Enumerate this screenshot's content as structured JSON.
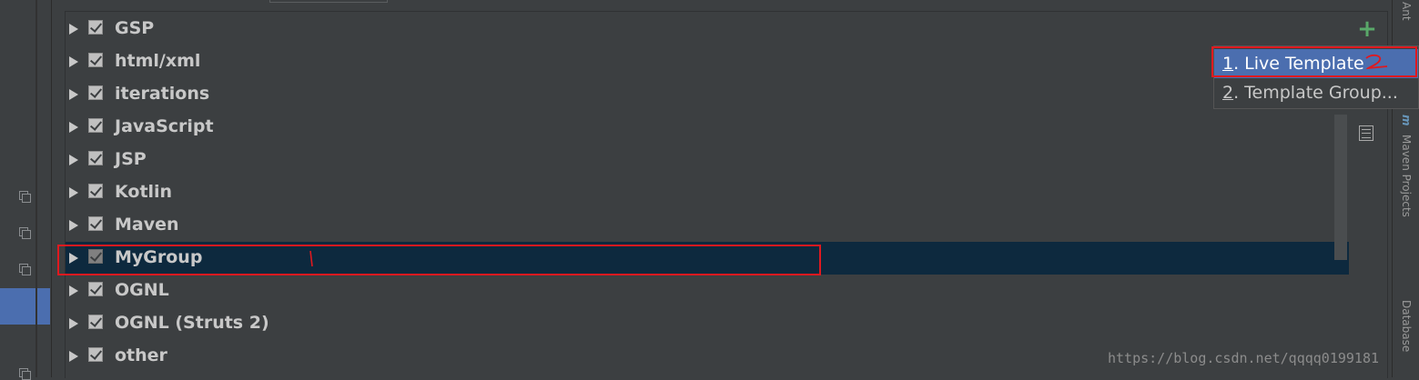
{
  "groups": [
    {
      "label": "GSP",
      "checked": true
    },
    {
      "label": "html/xml",
      "checked": true
    },
    {
      "label": "iterations",
      "checked": true
    },
    {
      "label": "JavaScript",
      "checked": true
    },
    {
      "label": "JSP",
      "checked": true
    },
    {
      "label": "Kotlin",
      "checked": true
    },
    {
      "label": "Maven",
      "checked": true
    },
    {
      "label": "MyGroup",
      "checked": true,
      "selected": true
    },
    {
      "label": "OGNL",
      "checked": true
    },
    {
      "label": "OGNL (Struts 2)",
      "checked": true
    },
    {
      "label": "other",
      "checked": true
    }
  ],
  "toolbar": {
    "add_icon": "plus-icon",
    "copy_icon": "document-icon",
    "add_color": "#59a869"
  },
  "popup_menu": {
    "items": [
      {
        "num": "1",
        "text": ". Live Template",
        "highlighted": true
      },
      {
        "num": "2",
        "text": ". Template Group...",
        "highlighted": false
      }
    ]
  },
  "annotations": {
    "mark_1": "1",
    "mark_2": "2",
    "color": "#e0191f"
  },
  "right_panel_tabs": [
    "Ant",
    "m",
    "Maven Projects",
    "Database"
  ],
  "watermark": "https://blog.csdn.net/qqqq0199181",
  "colors": {
    "background": "#3c3f41",
    "selection": "#0d293e",
    "menu_highlight": "#4b6eaf"
  }
}
